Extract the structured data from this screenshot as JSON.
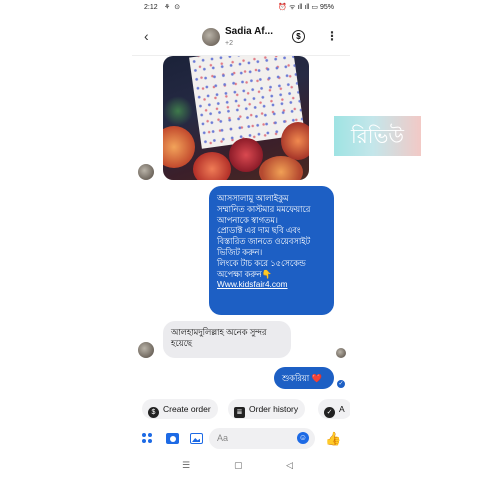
{
  "status_bar": {
    "time": "2:12",
    "left_icons": "⚘ ⊙",
    "right_icons": "⏰ ᯤ ıll ıll ▭",
    "battery": "95%"
  },
  "header": {
    "contact_name": "Sadia Af...",
    "subtitle": "+2",
    "back_icon": "‹",
    "dollar_icon": "$",
    "menu_icon": "⋮"
  },
  "messages": {
    "sent_main": {
      "lines": [
        "আসসালামু আলাইকুম",
        "সম্মানিত কাস্টমার মমফেয়ারে",
        "আপনাকে স্বাগতম।",
        "প্রোডাক্ট এর দাম ছবি এবং",
        "বিস্তারিত জানতে ওয়েবসাইট",
        "ভিজিট করুন।",
        "লিংকে টাচ করে ১৫সেকেন্ড",
        "অপেক্ষা করুন👇",
        "Www.kidsfair4.com"
      ]
    },
    "received": {
      "lines": [
        "আলহামদুলিল্লাহ অনেক সুন্দর",
        "হয়েছে"
      ]
    },
    "sent_reply": {
      "text": "শুকরিয়া",
      "emoji": "❤️"
    }
  },
  "quick_actions": [
    {
      "label": "Create order",
      "icon": "$"
    },
    {
      "label": "Order history",
      "icon": "≣"
    },
    {
      "label": "A",
      "icon": "✓"
    }
  ],
  "composer": {
    "placeholder": "Aa",
    "emoji_icon": "☺",
    "like_icon": "👍"
  },
  "navbar": {
    "recent": "☰",
    "home": "▢",
    "back": "◁"
  },
  "overlay": {
    "review_label": "রিভিউ"
  },
  "colors": {
    "accent": "#1d5fc4",
    "bubble_in": "#ebebee",
    "review_gradient": [
      "#9fe3e3",
      "#f2c9c6"
    ]
  }
}
